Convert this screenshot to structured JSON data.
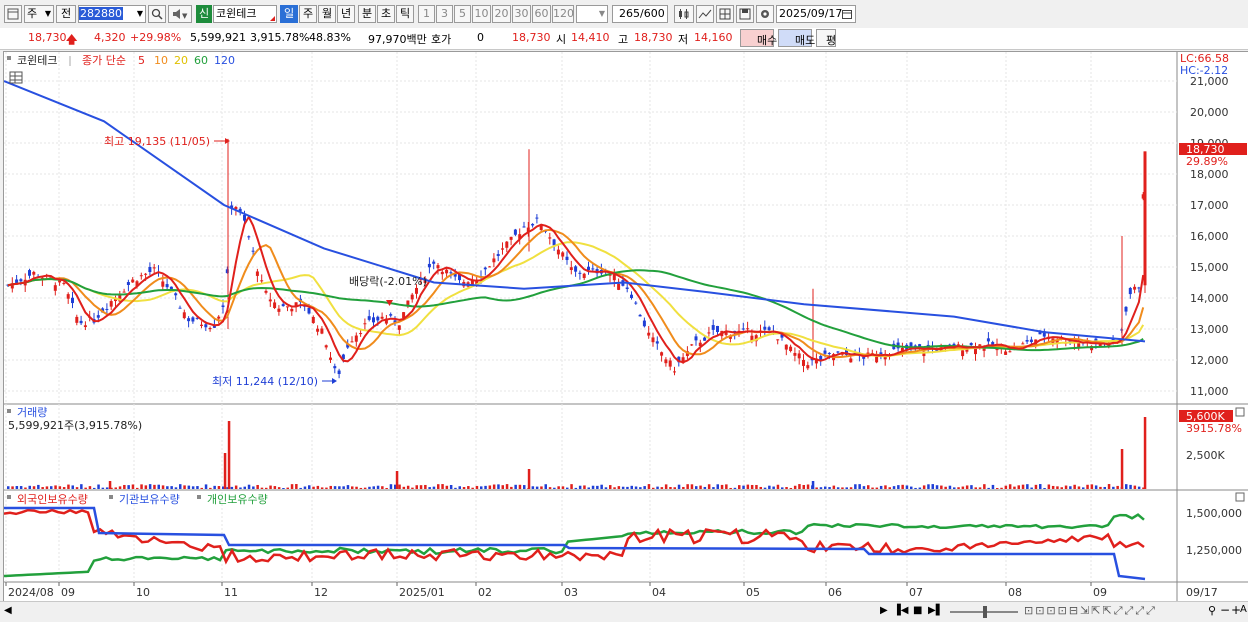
{
  "toolbar": {
    "market_label": "주",
    "prev_label": "전",
    "code": "282880",
    "new_label": "신",
    "stock_name": "코윈테크",
    "periods": [
      "일",
      "주",
      "월",
      "년",
      "분",
      "초",
      "틱"
    ],
    "intervals": [
      "1",
      "3",
      "5",
      "10",
      "20",
      "30",
      "60",
      "120"
    ],
    "count": "265",
    "count_max": "/600",
    "date": "2025/09/17"
  },
  "quote": {
    "price": "18,730",
    "change": "4,320",
    "change_pct": "+29.98%",
    "volume": "5,599,921",
    "volume_pct": "3,915.78%",
    "ratio": "48.83%",
    "amount": "97,970백만",
    "hoga_label": "호가",
    "hoga_value": "0",
    "hoga_price": "18,730",
    "open_label": "시",
    "open": "14,410",
    "high_label": "고",
    "high": "18,730",
    "low_label": "저",
    "low": "14,160",
    "buy_label": "매수",
    "sell_label": "매도",
    "eval_label": "평"
  },
  "price_panel": {
    "legend_name": "코윈테크",
    "legend_close": "종가 단순",
    "ma_periods": [
      "5",
      "10",
      "20",
      "60",
      "120"
    ],
    "lc": "LC:66.58",
    "hc": "HC:-2.12",
    "last_price": "18,730",
    "last_pct": "29.89%",
    "high_annot": "최고 19,135 (11/05)",
    "low_annot": "최저 11,244 (12/10)",
    "div_annot": "배당락(-2.01%)",
    "y_ticks": [
      "21,000",
      "20,000",
      "19,000",
      "18,000",
      "17,000",
      "16,000",
      "15,000",
      "14,000",
      "13,000",
      "12,000",
      "11,000"
    ]
  },
  "volume_panel": {
    "legend": "거래량",
    "value": "5,599,921주(3,915.78%)",
    "last_label": "5,600K",
    "last_pct": "3915.78%",
    "y_tick": "2,500K"
  },
  "holdings_panel": {
    "legends": [
      "외국인보유수량",
      "기관보유수량",
      "개인보유수량"
    ],
    "y_ticks": [
      "1,500,000",
      "1,250,000"
    ]
  },
  "x_axis": {
    "labels": [
      "2024/08",
      "09",
      "10",
      "11",
      "12",
      "2025/01",
      "02",
      "03",
      "04",
      "05",
      "06",
      "07",
      "08",
      "09"
    ],
    "right_label": "09/17"
  },
  "colors": {
    "up": "#e0201c",
    "down": "#1f3fd6",
    "ma5": "#e0201c",
    "ma10": "#f08c1c",
    "ma20": "#f0e040",
    "ma60": "#22a03c",
    "ma120": "#2850e0",
    "foreign": "#e0201c",
    "institution": "#2850e0",
    "individual": "#22a03c"
  }
}
